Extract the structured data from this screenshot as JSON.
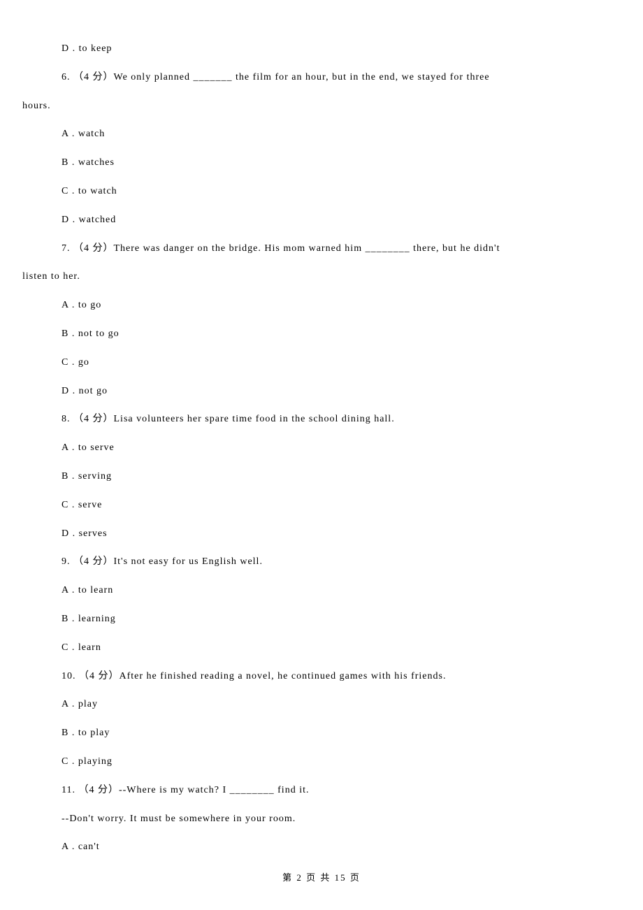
{
  "items": [
    {
      "type": "option",
      "text": "D . to keep"
    },
    {
      "type": "question",
      "text": "6. （4 分）We only planned _______ the film for an hour, but in the end, we stayed for three"
    },
    {
      "type": "continuation-left",
      "text": "hours."
    },
    {
      "type": "option",
      "text": "A . watch"
    },
    {
      "type": "option",
      "text": "B . watches"
    },
    {
      "type": "option",
      "text": "C . to watch"
    },
    {
      "type": "option",
      "text": "D . watched"
    },
    {
      "type": "question",
      "text": "7. （4 分）There was danger on the bridge. His mom warned him ________ there, but he didn't"
    },
    {
      "type": "continuation-left",
      "text": "listen to her."
    },
    {
      "type": "option",
      "text": "A . to go"
    },
    {
      "type": "option",
      "text": "B . not to go"
    },
    {
      "type": "option",
      "text": "C . go"
    },
    {
      "type": "option",
      "text": "D . not go"
    },
    {
      "type": "question",
      "text": "8. （4 分）Lisa volunteers her spare time      food in the school dining hall."
    },
    {
      "type": "option",
      "text": "A . to serve"
    },
    {
      "type": "option",
      "text": "B . serving"
    },
    {
      "type": "option",
      "text": "C . serve"
    },
    {
      "type": "option",
      "text": "D . serves"
    },
    {
      "type": "question",
      "text": "9. （4 分）It's not easy for us                   English well."
    },
    {
      "type": "option",
      "text": "A . to learn"
    },
    {
      "type": "option",
      "text": "B . learning"
    },
    {
      "type": "option",
      "text": "C . learn"
    },
    {
      "type": "question",
      "text": "10. （4 分）After he finished reading a novel, he continued           games with his friends."
    },
    {
      "type": "option",
      "text": "A . play"
    },
    {
      "type": "option",
      "text": "B . to play"
    },
    {
      "type": "option",
      "text": "C . playing"
    },
    {
      "type": "question",
      "text": "11. （4 分）--Where is my watch?  I ________ find it."
    },
    {
      "type": "continuation",
      "text": "--Don't worry. It must be somewhere in your room."
    },
    {
      "type": "option",
      "text": "A . can't"
    }
  ],
  "footer": "第 2 页 共 15 页"
}
